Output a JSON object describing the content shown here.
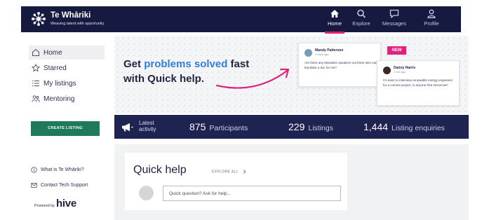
{
  "header": {
    "brand_name": "Te Whāriki",
    "brand_tagline": "Weaving talent with opportunity",
    "nav": [
      {
        "label": "Home",
        "icon": "home-icon",
        "active": true
      },
      {
        "label": "Explore",
        "icon": "search-icon",
        "active": false
      },
      {
        "label": "Messages",
        "icon": "message-icon",
        "active": false
      },
      {
        "label": "Profile",
        "icon": "user-icon",
        "active": false
      }
    ]
  },
  "sidebar": {
    "items": [
      {
        "label": "Home",
        "icon": "home-outline-icon"
      },
      {
        "label": "Starred",
        "icon": "star-icon"
      },
      {
        "label": "My listings",
        "icon": "list-icon"
      },
      {
        "label": "Mentoring",
        "icon": "people-icon"
      }
    ],
    "create_label": "CREATE LISTING",
    "help_links": [
      {
        "label": "What is Te Whāriki?",
        "icon": "info-circle-icon"
      },
      {
        "label": "Contact Tech Support",
        "icon": "mail-icon"
      }
    ],
    "powered_by": "Powered by",
    "powered_brand": "hive"
  },
  "hero": {
    "title_prefix": "Get ",
    "title_accent": "problems solved",
    "title_suffix": " fast",
    "title_line2": "with Quick help.",
    "badge": "NEW",
    "cards": [
      {
        "name": "Mandy Patterson",
        "time": "2 mins ago",
        "message": "Are there any Mandarin speakers out there who can translate a doc for me?"
      },
      {
        "name": "Danny Harris",
        "time": "1 min ago",
        "message": "I'm keen to interview renewable energy engineers for a comms project, is anyone free tomorrow?"
      }
    ]
  },
  "stats": {
    "latest_line1": "Latest",
    "latest_line2": "activity",
    "participants_value": "875",
    "participants_label": "Participants",
    "listings_value": "229",
    "listings_label": "Listings",
    "enquiries_value": "1,444",
    "enquiries_label": "Listing enquiries"
  },
  "quick_help": {
    "title": "Quick help",
    "explore_all": "EXPLORE ALL",
    "input_placeholder": "Quick question? Ask for help..."
  },
  "colors": {
    "header_bg": "#171a40",
    "stats_bg": "#1f2352",
    "accent_pink": "#e0237a",
    "accent_blue": "#2f7fd8",
    "create_green": "#1e7a5b"
  }
}
